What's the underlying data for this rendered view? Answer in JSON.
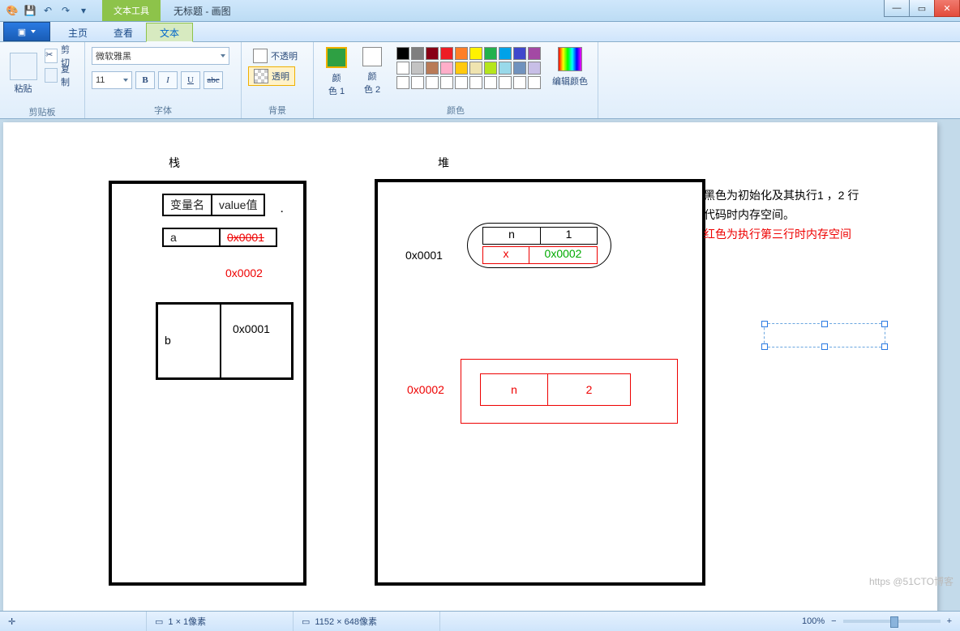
{
  "title": "无标题 - 画图",
  "context_tab": "文本工具",
  "file_btn": "▣",
  "tabs": {
    "home": "主页",
    "view": "查看",
    "text": "文本"
  },
  "ribbon": {
    "clipboard": {
      "label": "剪贴板",
      "paste": "粘贴",
      "cut": "剪切",
      "copy": "复制"
    },
    "font": {
      "label": "字体",
      "family": "微软雅黑",
      "size": "11",
      "bold": "B",
      "italic": "I",
      "underline": "U",
      "strike": "abc"
    },
    "background": {
      "label": "背景",
      "opaque": "不透明",
      "transparent": "透明"
    },
    "colors": {
      "label": "颜色",
      "color1": "颜\n色 1",
      "color2": "颜\n色 2",
      "edit": "编辑颜色",
      "c1_hex": "#2ea043"
    },
    "palette_row1": [
      "#000000",
      "#7f7f7f",
      "#880015",
      "#ed1c24",
      "#ff7f27",
      "#fff200",
      "#22b14c",
      "#00a2e8",
      "#3f48cc",
      "#a349a4"
    ],
    "palette_row2": [
      "#ffffff",
      "#c3c3c3",
      "#b97a57",
      "#ffaec9",
      "#ffc90e",
      "#efe4b0",
      "#b5e61d",
      "#99d9ea",
      "#7092be",
      "#c8bfe7"
    ],
    "palette_row3": [
      "#ffffff",
      "#ffffff",
      "#ffffff",
      "#ffffff",
      "#ffffff",
      "#ffffff",
      "#ffffff",
      "#ffffff",
      "#ffffff",
      "#ffffff"
    ]
  },
  "status": {
    "pos": "",
    "sel": "1 × 1像素",
    "size": "1152 × 648像素",
    "zoom": "100%",
    "zoom_minus": "−",
    "zoom_plus": "+"
  },
  "watermark": "https        @51CTO博客",
  "canvas": {
    "stack_title": "栈",
    "heap_title": "堆",
    "th_var": "变量名",
    "th_val": "value值",
    "a": "a",
    "a_val": "0x0001",
    "a_val2": "0x0002",
    "b": "b",
    "b_val": "0x0001",
    "h1_addr": "0x0001",
    "h1_n": "n",
    "h1_1": "1",
    "h1_x": "x",
    "h1_xv": "0x0002",
    "h2_addr": "0x0002",
    "h2_n": "n",
    "h2_2": "2",
    "note1": "黑色为初始化及其执行1 ，2 行",
    "note2": "代码时内存空间。",
    "note3": "红色为执行第三行时内存空间"
  }
}
